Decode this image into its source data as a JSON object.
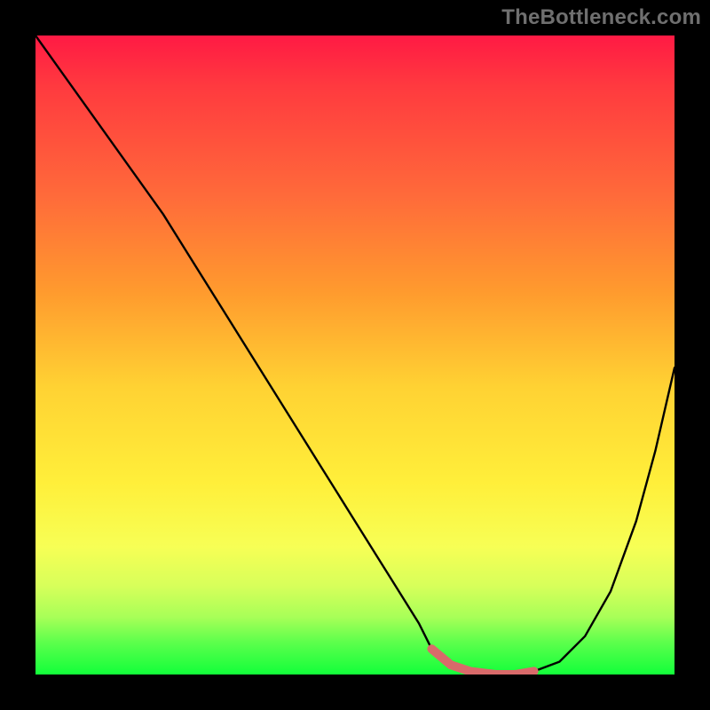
{
  "watermark": "TheBottleneck.com",
  "chart_data": {
    "type": "line",
    "title": "",
    "xlabel": "",
    "ylabel": "",
    "xlim": [
      0,
      100
    ],
    "ylim": [
      0,
      100
    ],
    "grid": false,
    "legend": false,
    "annotations": [],
    "series": [
      {
        "name": "bottleneck-curve",
        "color": "#000000",
        "x": [
          0,
          5,
          10,
          15,
          20,
          25,
          30,
          35,
          40,
          45,
          50,
          55,
          60,
          62,
          65,
          68,
          72,
          75,
          78,
          82,
          86,
          90,
          94,
          97,
          100
        ],
        "values": [
          100,
          93,
          86,
          79,
          72,
          64,
          56,
          48,
          40,
          32,
          24,
          16,
          8,
          4,
          1.5,
          0.5,
          0,
          0,
          0.5,
          2,
          6,
          13,
          24,
          35,
          48
        ]
      },
      {
        "name": "optimal-range-marker",
        "color": "#d96a6a",
        "x": [
          62,
          65,
          68,
          72,
          75,
          78
        ],
        "values": [
          4,
          1.5,
          0.5,
          0,
          0,
          0.5
        ]
      }
    ],
    "gradient_stops": [
      {
        "pos": 0,
        "color": "#ff1a44"
      },
      {
        "pos": 25,
        "color": "#ff6a3a"
      },
      {
        "pos": 55,
        "color": "#ffd233"
      },
      {
        "pos": 80,
        "color": "#f7ff55"
      },
      {
        "pos": 100,
        "color": "#12ff3a"
      }
    ]
  }
}
